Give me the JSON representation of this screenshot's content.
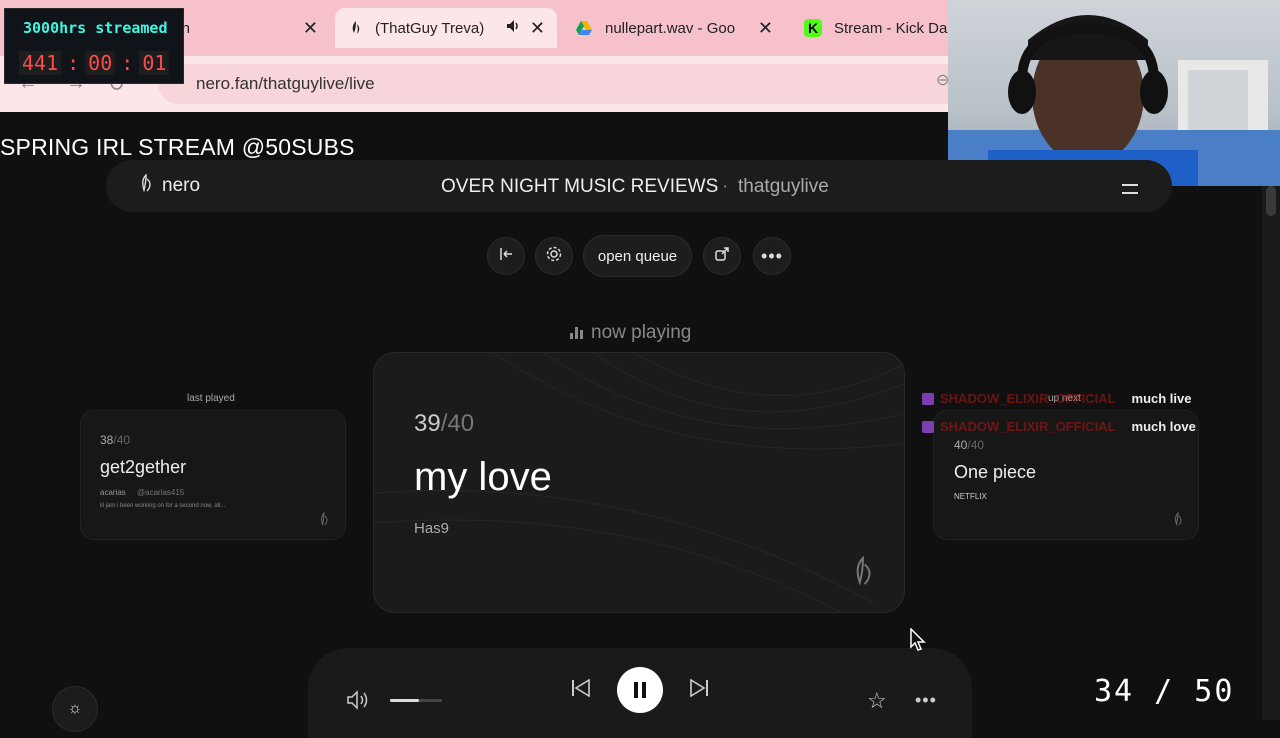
{
  "overlay": {
    "timer_label": "3000hrs streamed",
    "timer_hours": "441",
    "timer_minutes": "00",
    "timer_seconds": "01",
    "separator": ":",
    "banner": "SPRING IRL STREAM @50SUBS",
    "counter": "34 / 50"
  },
  "browser": {
    "tabs": [
      {
        "label": "tch",
        "active": false
      },
      {
        "label": "(ThatGuy Treva)",
        "active": true
      },
      {
        "label": "nullepart.wav - Goo",
        "active": false
      },
      {
        "label": "Stream - Kick Da",
        "active": false
      }
    ],
    "close_glyph": "✕",
    "url": "nero.fan/thatguylive/live"
  },
  "header": {
    "logo": "nero",
    "title": "OVER NIGHT MUSIC REVIEWS",
    "separator": "·",
    "username": "thatguylive"
  },
  "toolbar": {
    "queue_label": "open queue"
  },
  "now_playing_label": "now playing",
  "last_played": {
    "label": "last played",
    "count": "38",
    "total": "/40",
    "title": "get2gether",
    "artist": "acarias",
    "handle": "@acarias415",
    "description": "lil jam i been working on for a second now, all..."
  },
  "current": {
    "count": "39",
    "total": "/40",
    "title": "my love",
    "artist": "Has9"
  },
  "up_next": {
    "label": "up next",
    "count": "40",
    "total": "/40",
    "title": "One piece",
    "artist": "NETFLIX"
  },
  "chat": [
    {
      "user": "SHADOW_ELIXIR_OFFICIAL",
      "message": "much live"
    },
    {
      "user": "SHADOW_ELIXIR_OFFICIAL",
      "message": "much love"
    }
  ],
  "player": {
    "volume_level": 0.55
  },
  "colors": {
    "accent_timer": "#3ff7e4",
    "timer_digits": "#ff4a4a",
    "tabbar": "#f6c1cb"
  }
}
